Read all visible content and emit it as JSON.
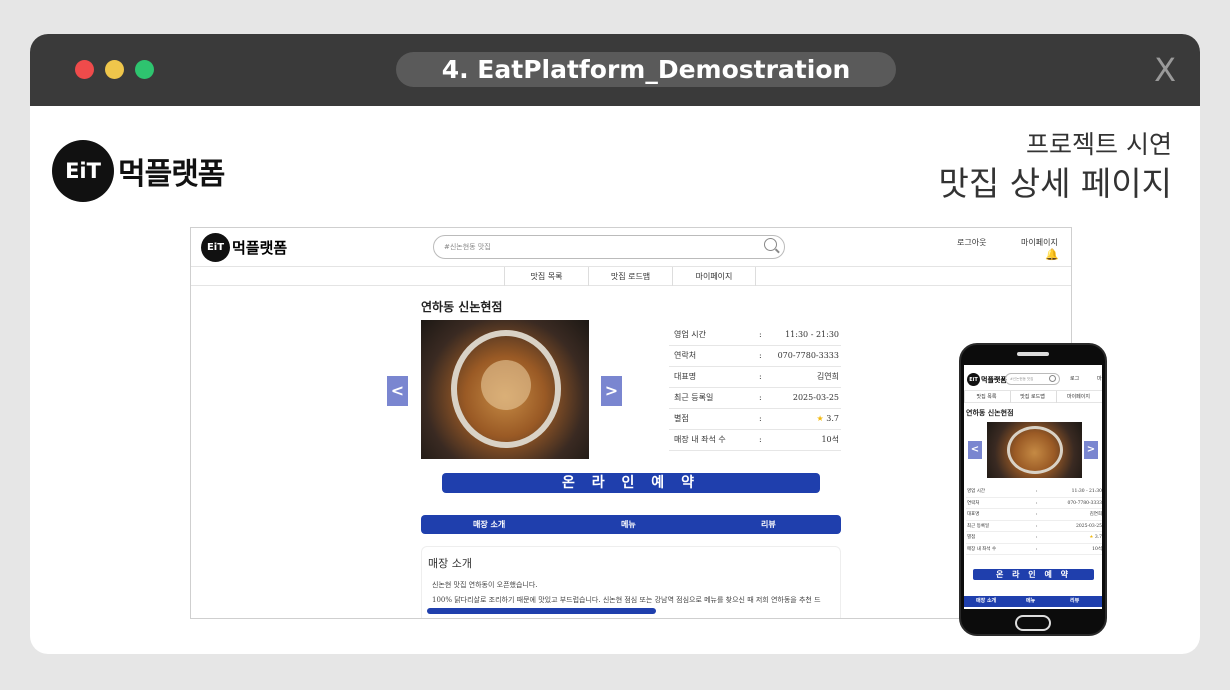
{
  "window": {
    "title": "4. EatPlatform_Demostration",
    "close_label": "X"
  },
  "brand": {
    "logo_mark": "EiT",
    "name": "먹플랫폼"
  },
  "slide": {
    "subtitle": "프로젝트 시연",
    "title": "맛집 상세 페이지"
  },
  "site": {
    "logo_mark": "EiT",
    "logo_text": "먹플랫폼",
    "search_placeholder": "#신논현동 맛집",
    "logout_label": "로그아웃",
    "mypage_label": "마이페이지",
    "nav": [
      "맛집 목록",
      "맛집 로드맵",
      "마이페이지"
    ],
    "restaurant_name": "연하동 신논현점",
    "prev_arrow": "<",
    "next_arrow": ">",
    "info": [
      {
        "label": "영업 시간",
        "sep": ":",
        "value": "11:30 - 21:30"
      },
      {
        "label": "연락처",
        "sep": ":",
        "value": "070-7780-3333"
      },
      {
        "label": "대표명",
        "sep": ":",
        "value": "김연희"
      },
      {
        "label": "최근 등록일",
        "sep": ":",
        "value": "2025-03-25"
      },
      {
        "label": "별점",
        "sep": ":",
        "star": "★",
        "value": "3.7"
      },
      {
        "label": "매장 내 좌석 수",
        "sep": ":",
        "value": "10석"
      }
    ],
    "reserve_label": "온 라 인  예 약",
    "tabs": [
      "매장 소개",
      "메뉴",
      "리뷰"
    ],
    "intro": {
      "heading": "매장 소개",
      "line1": "신논현 맛집 연하동이 오픈했습니다.",
      "line2": "100% 닭다리살로 조리하기 때문에 맛있고 부드럽습니다. 신논현 점심 또는 강남역 점심으로 메뉴를 찾으신 때 저희 연하동을 추천 드"
    }
  },
  "mobile": {
    "search_placeholder": "#신논현동 맛집",
    "logout_label": "로그",
    "mypage_label": "마"
  },
  "colors": {
    "titlebar": "#3a3a3a",
    "accent_blue": "#1f3fad",
    "arrow_purple": "#7a86d0",
    "star": "#f2b90f"
  }
}
